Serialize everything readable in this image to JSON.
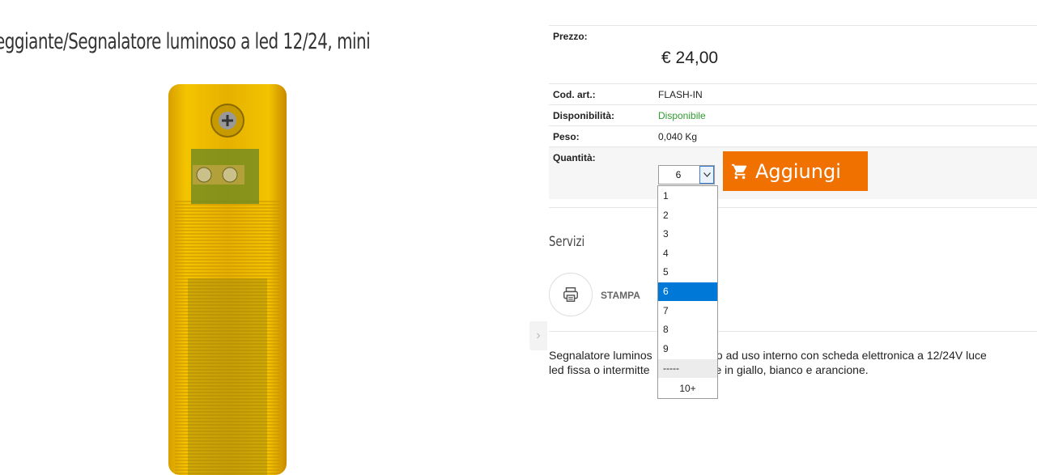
{
  "product": {
    "title": "eggiante/Segnalatore luminoso a led 12/24, mini",
    "price_label": "Prezzo:",
    "price": "€  24,00",
    "code_label": "Cod. art.:",
    "code": "FLASH-IN",
    "availability_label": "Disponibilità:",
    "availability": "Disponibile",
    "weight_label": "Peso:",
    "weight": "0,040 Kg",
    "quantity_label": "Quantità:",
    "quantity_selected": "6",
    "add_button": "Aggiungi",
    "description_line1": "Segnalatore luminos",
    "description_line1b": "onato ad uso interno con scheda elettronica a 12/24V luce",
    "description_line2": "led fissa o intermitte",
    "description_line2b": "bile in giallo, bianco e arancione."
  },
  "dropdown": {
    "options": [
      "1",
      "2",
      "3",
      "4",
      "5",
      "6",
      "7",
      "8",
      "9",
      "-----",
      "10+"
    ],
    "selected": "6"
  },
  "services": {
    "title": "Servizi",
    "print_label": "STAMPA"
  },
  "colors": {
    "accent": "#f07000",
    "available": "#2e9c2e",
    "selection": "#0078d7"
  },
  "icons": {
    "cart": "cart-icon",
    "print": "printer-icon",
    "arrow": "chevron-right-icon",
    "select": "chevron-down-icon"
  }
}
